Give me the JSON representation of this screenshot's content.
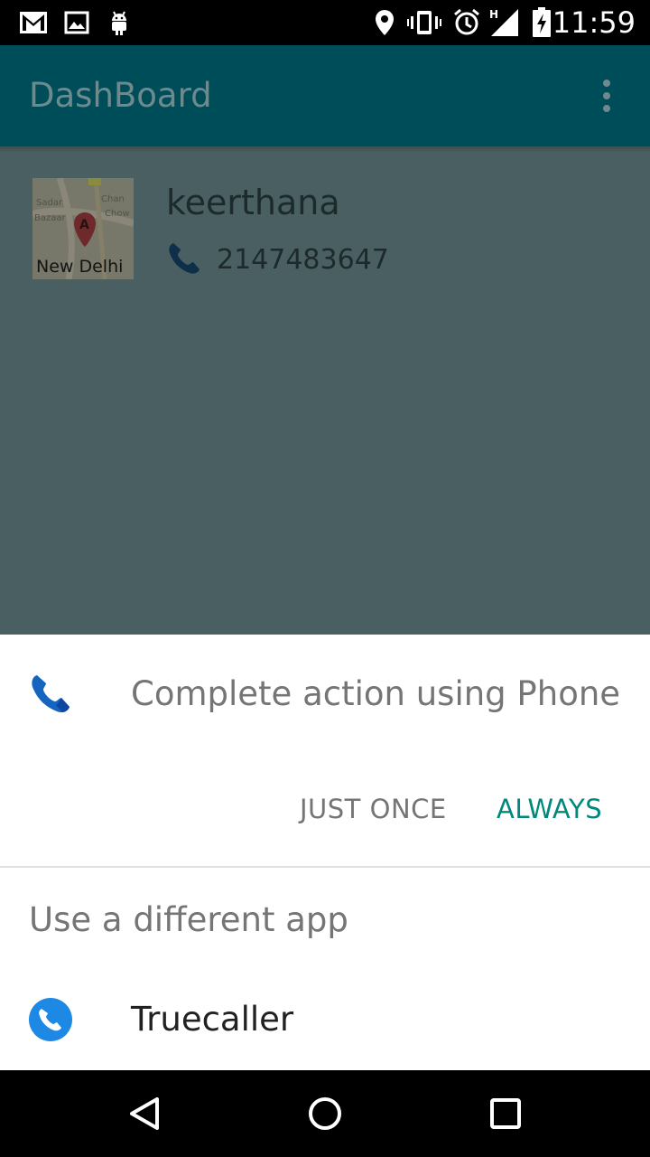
{
  "status_bar": {
    "time": "11:59",
    "icons": [
      "gmail-icon",
      "gallery-icon",
      "android-icon",
      "location-icon",
      "vibrate-icon",
      "alarm-icon",
      "signal-h-icon",
      "battery-charging-icon"
    ]
  },
  "app_bar": {
    "title": "DashBoard",
    "overflow_icon": "more-vert-icon"
  },
  "contact": {
    "name": "keerthana",
    "phone": "2147483647",
    "thumbnail_icon": "map-thumbnail",
    "thumbnail_text": "New Delhi"
  },
  "chooser": {
    "title": "Complete action using Phone",
    "just_once_label": "JUST ONCE",
    "always_label": "ALWAYS",
    "different_app_label": "Use a different app",
    "apps": [
      {
        "label": "Truecaller",
        "icon": "truecaller-icon"
      }
    ],
    "accent_color": "#00897b"
  },
  "nav_bar": {
    "buttons": [
      "back-icon",
      "home-icon",
      "recents-icon"
    ]
  }
}
